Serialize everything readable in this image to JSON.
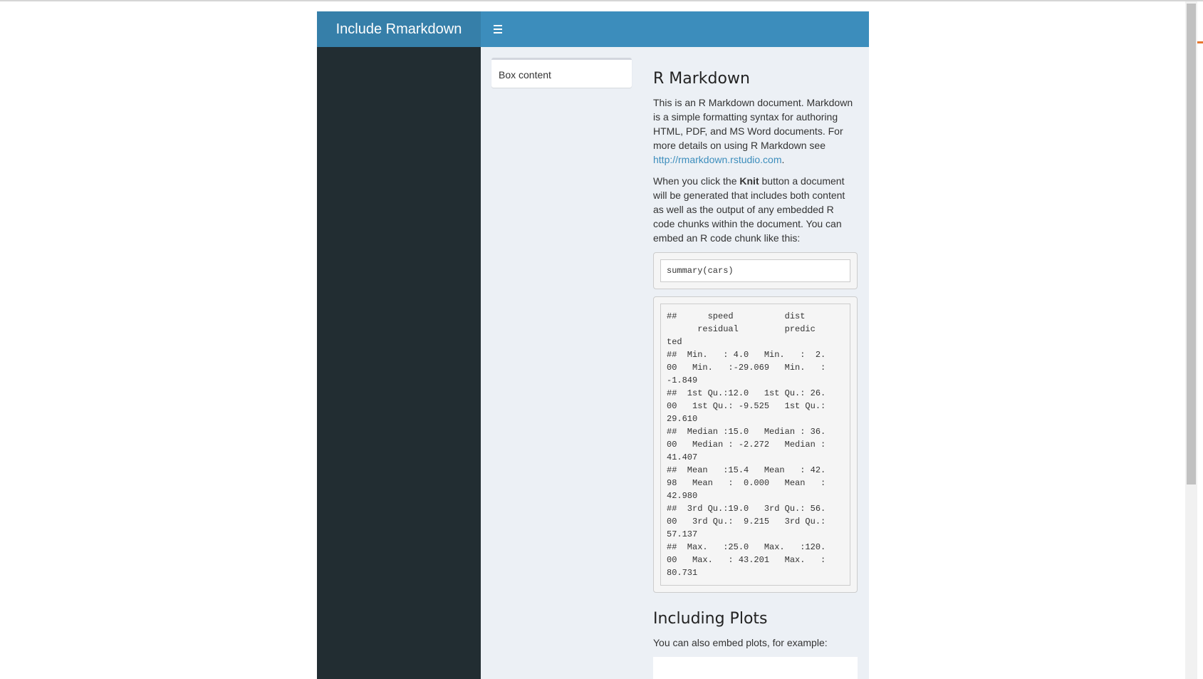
{
  "header": {
    "title": "Include Rmarkdown",
    "toggle_icon": "hamburger-menu-icon"
  },
  "box": {
    "content": "Box content"
  },
  "doc": {
    "heading1": "R Markdown",
    "p1_text": "This is an R Markdown document. Markdown is a simple formatting syntax for authoring HTML, PDF, and MS Word documents. For more details on using R Markdown see ",
    "p1_link": "http://rmarkdown.rstudio.com",
    "p1_end": ".",
    "p2_pre": "When you click the ",
    "p2_bold": "Knit",
    "p2_post": " button a document will be generated that includes both content as well as the output of any embedded R code chunks within the document. You can embed an R code chunk like this:",
    "code": "summary(cars)",
    "output_lines": [
      "##      speed          dist   ",
      "      residual         predic",
      "ted",
      "##  Min.   : 4.0   Min.   :  2.",
      "00   Min.   :-29.069   Min.   :",
      "-1.849",
      "##  1st Qu.:12.0   1st Qu.: 26.",
      "00   1st Qu.: -9.525   1st Qu.:",
      "29.610",
      "##  Median :15.0   Median : 36.",
      "00   Median : -2.272   Median :",
      "41.407",
      "##  Mean   :15.4   Mean   : 42.",
      "98   Mean   :  0.000   Mean   :",
      "42.980",
      "##  3rd Qu.:19.0   3rd Qu.: 56.",
      "00   3rd Qu.:  9.215   3rd Qu.:",
      "57.137",
      "##  Max.   :25.0   Max.   :120.",
      "00   Max.   : 43.201   Max.   :",
      "80.731"
    ],
    "heading2": "Including Plots",
    "p3": "You can also embed plots, for example:"
  }
}
